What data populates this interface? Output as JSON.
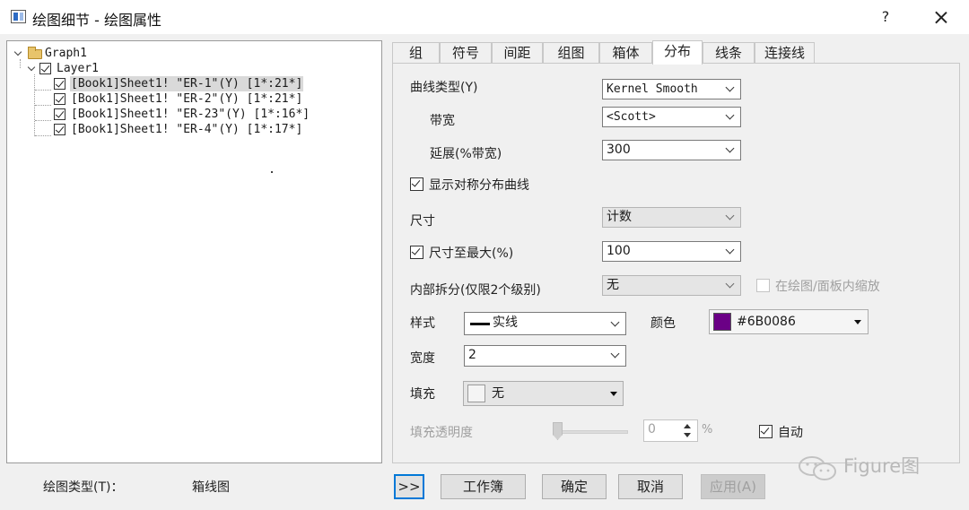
{
  "window": {
    "title": "绘图细节 - 绘图属性",
    "help_label": "?"
  },
  "tree": {
    "root_label": "Graph1",
    "layer_label": "Layer1",
    "items": [
      {
        "label": "[Book1]Sheet1! \"ER-1\"(Y) [1*:21*]",
        "checked": true,
        "selected": true
      },
      {
        "label": "[Book1]Sheet1! \"ER-2\"(Y) [1*:21*]",
        "checked": true,
        "selected": false
      },
      {
        "label": "[Book1]Sheet1! \"ER-23\"(Y) [1*:16*]",
        "checked": true,
        "selected": false
      },
      {
        "label": "[Book1]Sheet1! \"ER-4\"(Y) [1*:17*]",
        "checked": true,
        "selected": false
      }
    ]
  },
  "plot_type": {
    "label": "绘图类型(T)：",
    "value": "箱线图"
  },
  "tabs": [
    {
      "label": "组",
      "active": false
    },
    {
      "label": "符号",
      "active": false
    },
    {
      "label": "间距",
      "active": false
    },
    {
      "label": "组图",
      "active": false
    },
    {
      "label": "箱体",
      "active": false
    },
    {
      "label": "分布",
      "active": true
    },
    {
      "label": "线条",
      "active": false
    },
    {
      "label": "连接线",
      "active": false
    }
  ],
  "distribution": {
    "curve_type_label": "曲线类型(Y)",
    "curve_type_value": "Kernel Smooth",
    "bandwidth_label": "带宽",
    "bandwidth_value": "<Scott>",
    "extend_label": "延展(%带宽)",
    "extend_value": "300",
    "show_symmetric_label": "显示对称分布曲线",
    "show_symmetric_checked": true,
    "size_label": "尺寸",
    "size_value": "计数",
    "size_max_label": "尺寸至最大(%)",
    "size_max_checked": true,
    "size_max_value": "100",
    "inner_split_label": "内部拆分(仅限2个级别)",
    "inner_split_value": "无",
    "scale_in_plot_label": "在绘图/面板内缩放",
    "scale_in_plot_checked": false,
    "style_label": "样式",
    "style_value": "实线",
    "color_label": "颜色",
    "color_value": "#6B0086",
    "color_hex": "#6B0086",
    "width_label": "宽度",
    "width_value": "2",
    "fill_label": "填充",
    "fill_value": "无",
    "fill_transparency_label": "填充透明度",
    "fill_transparency_value": "0",
    "fill_transparency_unit": "%",
    "auto_label": "自动",
    "auto_checked": true
  },
  "buttons": {
    "expand_label": ">>",
    "workbook_label": "工作簿",
    "ok_label": "确定",
    "cancel_label": "取消",
    "apply_label": "应用(A)"
  },
  "watermark": {
    "text": "Figure图"
  }
}
